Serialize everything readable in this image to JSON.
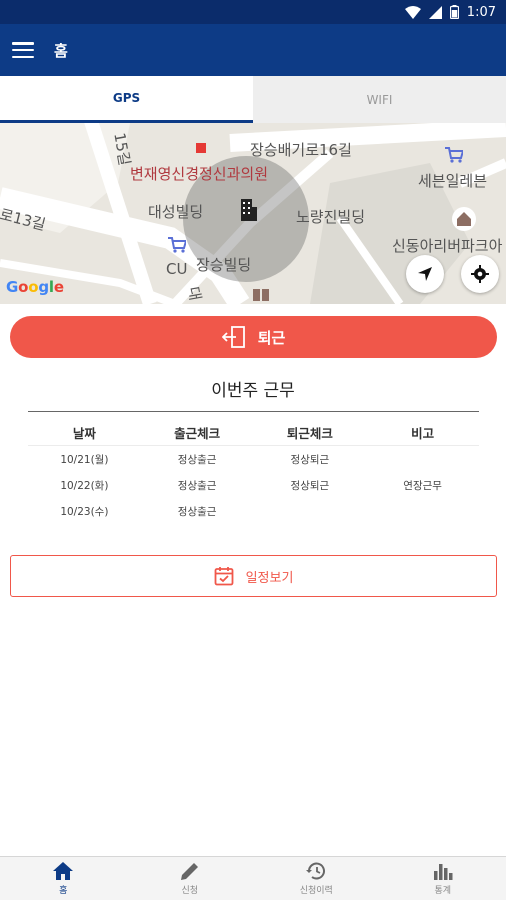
{
  "status_bar": {
    "time": "1:07"
  },
  "app_bar": {
    "title": "홈"
  },
  "tabs": [
    {
      "label": "GPS",
      "active": true
    },
    {
      "label": "WIFI",
      "active": false
    }
  ],
  "map": {
    "labels": {
      "street_top": "장승배기로16길",
      "street_left": "로13길",
      "street_vertical": "15길",
      "clinic": "변재영신경정신과의원",
      "seven_eleven": "세븐일레븐",
      "daesung": "대성빌딩",
      "noryangjin": "노량진빌딩",
      "cu": "CU",
      "jangseung": "장승빌딩",
      "sindong": "신동아리버파크아",
      "road_fragment": "대"
    },
    "google_logo": "Google"
  },
  "actions": {
    "checkout_label": "퇴근",
    "schedule_label": "일정보기"
  },
  "week": {
    "title": "이번주 근무",
    "columns": [
      "날짜",
      "출근체크",
      "퇴근체크",
      "비고"
    ],
    "rows": [
      [
        "10/21(월)",
        "정상출근",
        "정상퇴근",
        ""
      ],
      [
        "10/22(화)",
        "정상출근",
        "정상퇴근",
        "연장근무"
      ],
      [
        "10/23(수)",
        "정상출근",
        "",
        ""
      ]
    ]
  },
  "bottom_nav": [
    {
      "label": "홈",
      "icon": "home-icon",
      "active": true
    },
    {
      "label": "신청",
      "icon": "pencil-icon",
      "active": false
    },
    {
      "label": "신청이력",
      "icon": "history-icon",
      "active": false
    },
    {
      "label": "통계",
      "icon": "bar-chart-icon",
      "active": false
    }
  ],
  "colors": {
    "primary": "#0d3b86",
    "status_bar": "#0b2c6b",
    "accent": "#f0574a"
  }
}
